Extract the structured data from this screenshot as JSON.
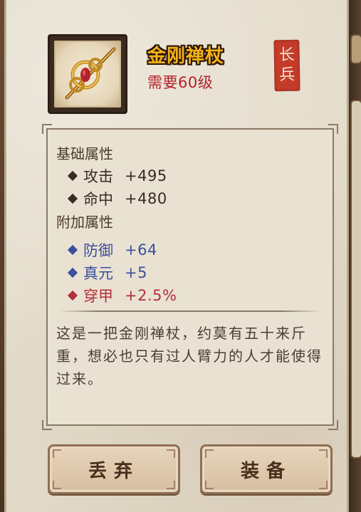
{
  "item": {
    "name": "金刚禅杖",
    "requirement": "需要60级",
    "type_badge": [
      "长",
      "兵"
    ],
    "icon": "golden-staff-icon"
  },
  "base_attributes": {
    "title": "基础属性",
    "stats": [
      {
        "name": "攻击",
        "value": "+495"
      },
      {
        "name": "命中",
        "value": "+480"
      }
    ]
  },
  "extra_attributes": {
    "title": "附加属性",
    "stats": [
      {
        "name": "防御",
        "value": "+64"
      },
      {
        "name": "真元",
        "value": "+5"
      },
      {
        "name": "穿甲",
        "value": "+2.5%"
      }
    ]
  },
  "description": "这是一把金刚禅杖，约莫有五十来斤重，想必也只有过人臂力的人才能使得过来。",
  "buttons": {
    "discard": "丢弃",
    "equip": "装备"
  },
  "colors": {
    "item_name": "#f2b21a",
    "requirement": "#b3212a",
    "stat_base": "#3a2c22",
    "stat_blue": "#3c4f9c",
    "stat_red": "#b42f3a",
    "seal": "#c43b2a"
  }
}
